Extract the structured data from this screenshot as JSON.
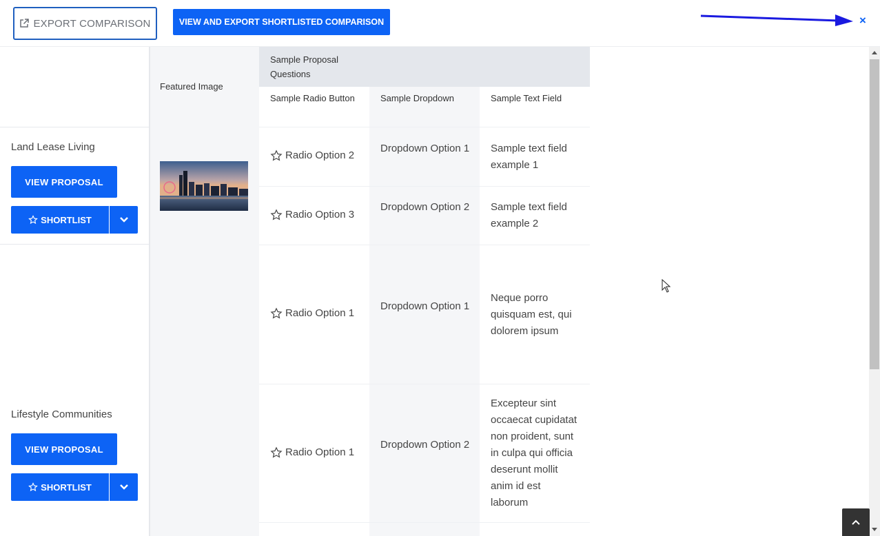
{
  "header": {
    "export_label": "EXPORT COMPARISON",
    "export_shortlisted_label": "VIEW AND EXPORT SHORTLISTED COMPARISON",
    "close_label": "×"
  },
  "vendors": [
    {
      "name": "Land Lease Living",
      "view_label": "VIEW PROPOSAL",
      "shortlist_label": "SHORTLIST"
    },
    {
      "name": "Lifestyle Communities",
      "view_label": "VIEW PROPOSAL",
      "shortlist_label": "SHORTLIST"
    }
  ],
  "table": {
    "featured_header": "Featured Image",
    "group_header": "Sample Proposal Questions",
    "columns": [
      "Sample Radio Button",
      "Sample Dropdown",
      "Sample Text Field"
    ],
    "rows": [
      {
        "radio": "Radio Option 2",
        "dropdown": "Dropdown Option 1",
        "text": "Sample text field example 1"
      },
      {
        "radio": "Radio Option 3",
        "dropdown": "Dropdown Option 2",
        "text": "Sample text field example 2"
      },
      {
        "radio": "Radio Option 1",
        "dropdown": "Dropdown Option 1",
        "text": "Neque porro quisquam est, qui dolorem ipsum"
      },
      {
        "radio": "Radio Option 1",
        "dropdown": "Dropdown Option 2",
        "text": "Excepteur sint occaecat cupidatat non proident, sunt in culpa qui officia deserunt mollit anim id est laborum"
      }
    ]
  },
  "icons": {
    "external_link": "external-link-icon",
    "star": "star-outline-icon",
    "chevron": "chevron-down-icon",
    "close": "close-icon",
    "back_to_top": "chevron-up-icon"
  },
  "colors": {
    "accent": "#0d63f5",
    "header_bg": "#e4e7ec",
    "alt_col": "#f5f6f8"
  }
}
